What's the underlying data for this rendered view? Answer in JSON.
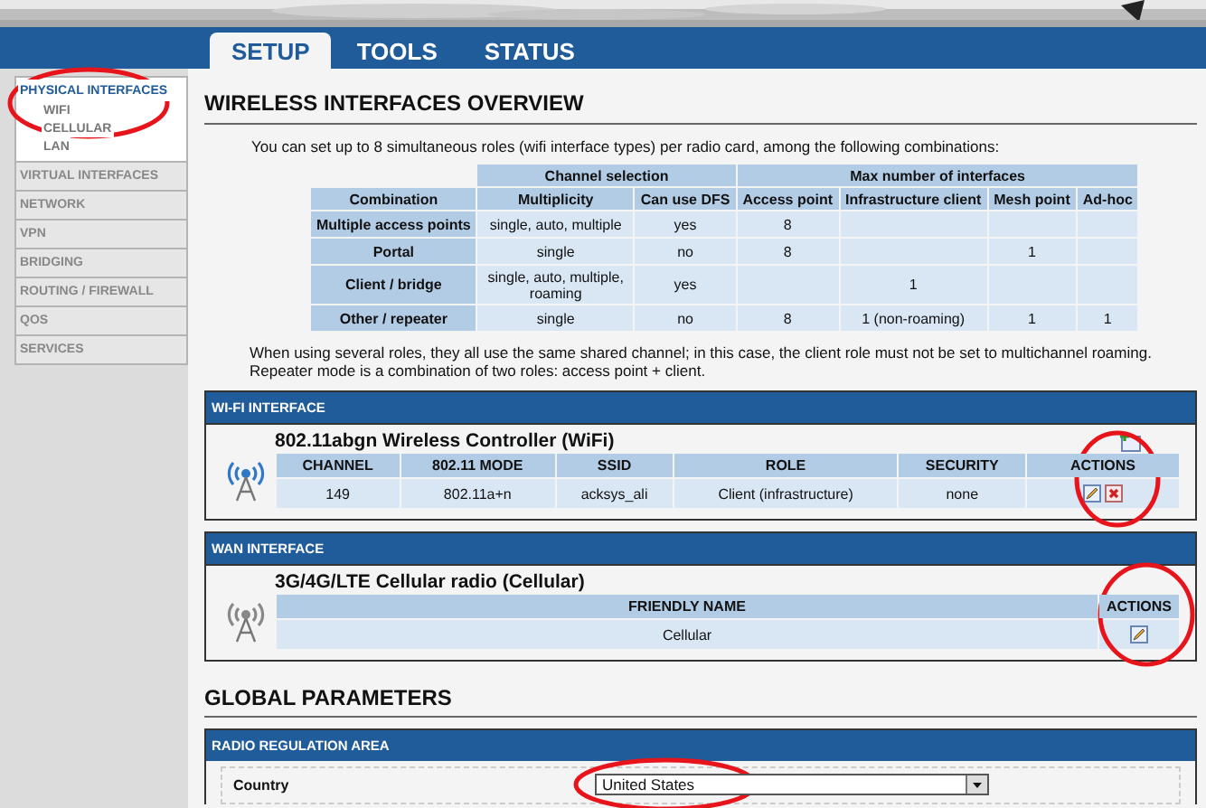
{
  "tabs": [
    {
      "label": "SETUP",
      "selected": true
    },
    {
      "label": "TOOLS",
      "selected": false
    },
    {
      "label": "STATUS",
      "selected": false
    }
  ],
  "sidebar": {
    "items": [
      {
        "label": "PHYSICAL INTERFACES",
        "selected": true,
        "children": [
          {
            "label": "WIFI"
          },
          {
            "label": "CELLULAR"
          },
          {
            "label": "LAN"
          }
        ]
      },
      {
        "label": "VIRTUAL INTERFACES",
        "selected": false
      },
      {
        "label": "NETWORK",
        "selected": false
      },
      {
        "label": "VPN",
        "selected": false
      },
      {
        "label": "BRIDGING",
        "selected": false
      },
      {
        "label": "ROUTING / FIREWALL",
        "selected": false
      },
      {
        "label": "QOS",
        "selected": false
      },
      {
        "label": "SERVICES",
        "selected": false
      }
    ]
  },
  "overview": {
    "title": "WIRELESS INTERFACES OVERVIEW",
    "intro": "You can set up to 8 simultaneous roles (wifi interface types) per radio card, among the following combinations:",
    "table": {
      "group_headers": [
        {
          "label": "Channel selection"
        },
        {
          "label": "Max number of interfaces"
        }
      ],
      "columns": [
        "Combination",
        "Multiplicity",
        "Can use DFS",
        "Access point",
        "Infrastructure client",
        "Mesh point",
        "Ad-hoc"
      ],
      "rows": [
        [
          "Multiple access points",
          "single, auto, multiple",
          "yes",
          "8",
          "",
          "",
          ""
        ],
        [
          "Portal",
          "single",
          "no",
          "8",
          "",
          "1",
          ""
        ],
        [
          "Client / bridge",
          "single, auto, multiple, roaming",
          "yes",
          "",
          "1",
          "",
          ""
        ],
        [
          "Other / repeater",
          "single",
          "no",
          "8",
          "1 (non-roaming)",
          "1",
          "1"
        ]
      ]
    },
    "notes": [
      "When using several roles, they all use the same shared channel; in this case, the client role must not be set to multichannel roaming.",
      "Repeater mode is a combination of two roles: access point + client."
    ]
  },
  "interfaces": [
    {
      "header": "WI-FI INTERFACE",
      "name": "802.11abgn Wireless Controller (WiFi)",
      "kind": "wifi",
      "add_action": true,
      "columns": [
        "CHANNEL",
        "802.11 MODE",
        "SSID",
        "ROLE",
        "SECURITY",
        "ACTIONS"
      ],
      "rows": [
        {
          "cells": [
            "149",
            "802.11a+n",
            "acksys_ali",
            "Client (infrastructure)",
            "none"
          ],
          "can_edit": true,
          "can_delete": true
        }
      ]
    },
    {
      "header": "WAN INTERFACE",
      "name": "3G/4G/LTE Cellular radio (Cellular)",
      "kind": "cellular",
      "add_action": false,
      "columns": [
        "FRIENDLY NAME",
        "ACTIONS"
      ],
      "rows": [
        {
          "cells": [
            "Cellular"
          ],
          "can_edit": true,
          "can_delete": false
        }
      ]
    }
  ],
  "global_parameters": {
    "title": "GLOBAL PARAMETERS",
    "sections": [
      {
        "header": "RADIO REGULATION AREA",
        "fields": [
          {
            "label": "Country",
            "value": "United States"
          }
        ]
      }
    ]
  },
  "annotations": [
    {
      "kind": "ellipse"
    },
    {
      "kind": "ellipse"
    },
    {
      "kind": "ellipse"
    },
    {
      "kind": "ellipse"
    }
  ]
}
